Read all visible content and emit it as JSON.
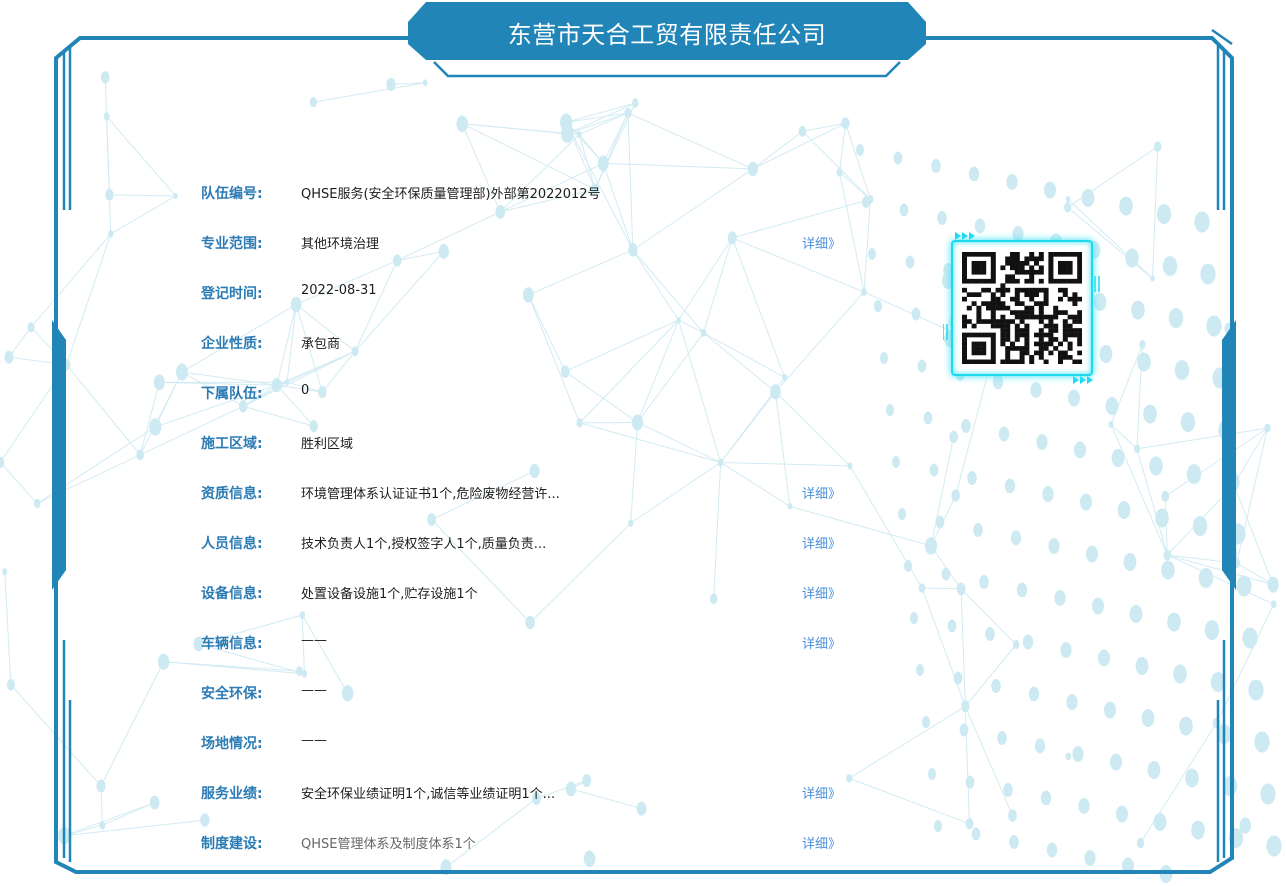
{
  "company": {
    "name": "东营市天合工贸有限责任公司"
  },
  "qr_code": {
    "icon": "qr-code-icon",
    "glow_color": "#1ed8f0"
  },
  "colors": {
    "accent": "#2b7bb5",
    "frame": "#2185b8",
    "link": "#4a90d9"
  },
  "fields": [
    {
      "key": "team-number",
      "label": "队伍编号:",
      "value": "QHSE服务(安全环保质量管理部)外部第2022012号",
      "detail": ""
    },
    {
      "key": "business-scope",
      "label": "专业范围:",
      "value": "其他环境治理",
      "detail": "详细》"
    },
    {
      "key": "registration-date",
      "label": "登记时间:",
      "value": "2022-08-31",
      "detail": ""
    },
    {
      "key": "enterprise-type",
      "label": "企业性质:",
      "value": "承包商",
      "detail": ""
    },
    {
      "key": "sub-teams",
      "label": "下属队伍:",
      "value": "0",
      "detail": ""
    },
    {
      "key": "construction-area",
      "label": "施工区域:",
      "value": "胜利区域",
      "detail": ""
    },
    {
      "key": "qualification-info",
      "label": "资质信息:",
      "value": "环境管理体系认证证书1个,危险废物经营许...",
      "detail": "详细》"
    },
    {
      "key": "personnel-info",
      "label": "人员信息:",
      "value": "技术负责人1个,授权签字人1个,质量负责...",
      "detail": "详细》"
    },
    {
      "key": "equipment-info",
      "label": "设备信息:",
      "value": "处置设备设施1个,贮存设施1个",
      "detail": "详细》"
    },
    {
      "key": "vehicle-info",
      "label": "车辆信息:",
      "value": "——",
      "detail": "详细》"
    },
    {
      "key": "safety-env",
      "label": "安全环保:",
      "value": "——",
      "detail": ""
    },
    {
      "key": "site-status",
      "label": "场地情况:",
      "value": "——",
      "detail": ""
    },
    {
      "key": "service-performance",
      "label": "服务业绩:",
      "value": "安全环保业绩证明1个,诚信等业绩证明1个...",
      "detail": "详细》"
    },
    {
      "key": "system-construction",
      "label": "制度建设:",
      "value": "QHSE管理体系及制度体系1个",
      "detail": "详细》"
    }
  ]
}
